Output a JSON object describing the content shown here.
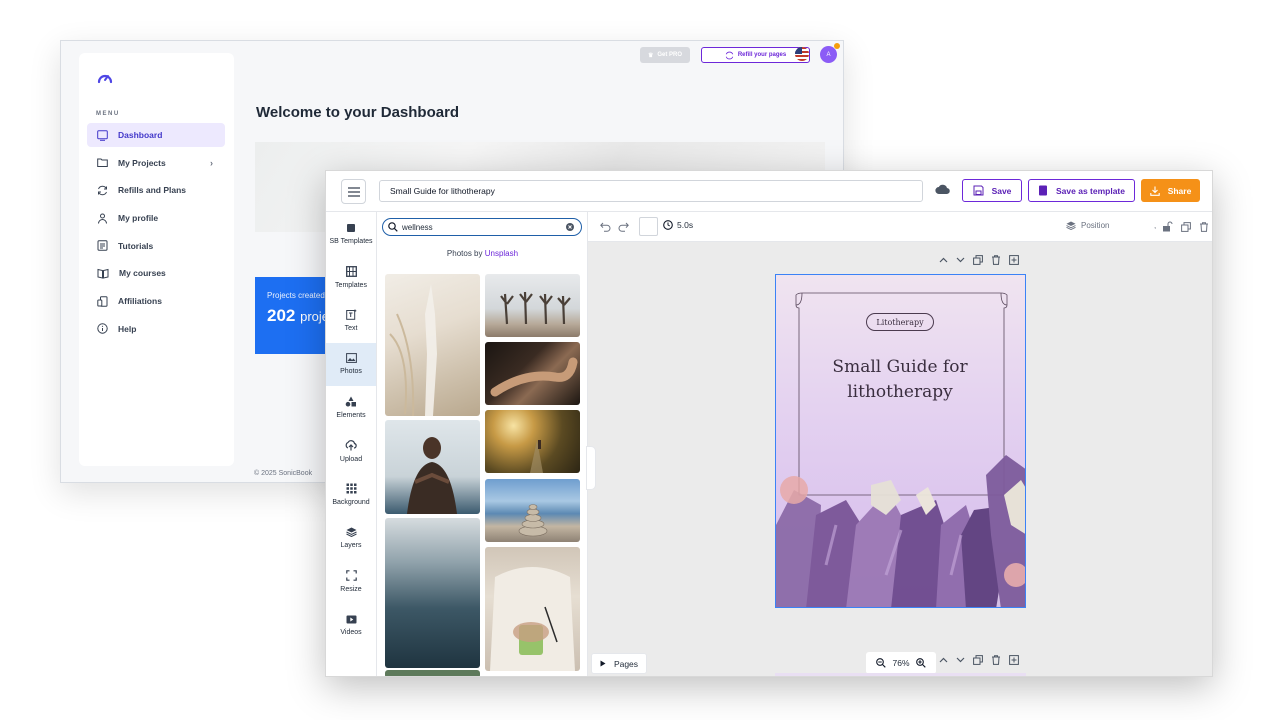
{
  "dashboard": {
    "menu_title": "MENU",
    "nav": [
      {
        "label": "Dashboard"
      },
      {
        "label": "My Projects"
      },
      {
        "label": "Refills and Plans"
      },
      {
        "label": "My profile"
      },
      {
        "label": "Tutorials"
      },
      {
        "label": "My courses"
      },
      {
        "label": "Affiliations"
      },
      {
        "label": "Help"
      }
    ],
    "get_pro": "Get PRO",
    "refill": "Refill your pages",
    "avatar_initial": "A",
    "welcome": "Welcome to your Dashboard",
    "stat_label": "Projects created",
    "stat_value": "202",
    "stat_unit": "projects",
    "footer": "© 2025 SonicBook"
  },
  "editor": {
    "doc_title": "Small Guide for lithotherapy",
    "save": "Save",
    "save_template": "Save as template",
    "share": "Share",
    "tools": [
      {
        "label": "SB Templates",
        "icon": "sb-templates-icon"
      },
      {
        "label": "Templates",
        "icon": "templates-icon"
      },
      {
        "label": "Text",
        "icon": "text-icon"
      },
      {
        "label": "Photos",
        "icon": "photos-icon"
      },
      {
        "label": "Elements",
        "icon": "elements-icon"
      },
      {
        "label": "Upload",
        "icon": "upload-icon"
      },
      {
        "label": "Background",
        "icon": "background-icon"
      },
      {
        "label": "Layers",
        "icon": "layers-icon"
      },
      {
        "label": "Resize",
        "icon": "resize-icon"
      },
      {
        "label": "Videos",
        "icon": "videos-icon"
      }
    ],
    "active_tool": "Photos",
    "search_value": "wellness",
    "photos_by": "Photos by",
    "photos_source": "Unsplash",
    "duration": "5.0s",
    "position": "Position",
    "page_pill": "Litotherapy",
    "page_title_line1": "Small Guide for",
    "page_title_line2": "lithotherapy",
    "pages_btn": "Pages",
    "zoom": "76%"
  },
  "colors": {
    "accent": "#6d28d9",
    "share": "#f59118",
    "stat_card": "#1d6ff2",
    "selection": "#3b82f6"
  }
}
